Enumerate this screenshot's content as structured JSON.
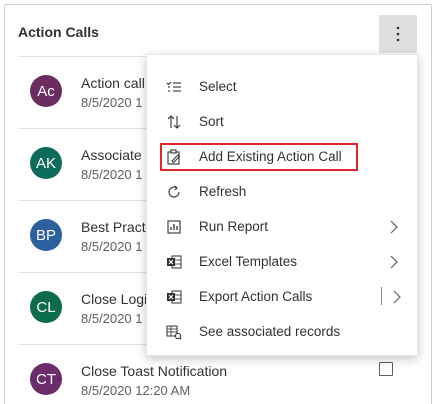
{
  "header": {
    "title": "Action Calls",
    "more_icon": "more-vertical-icon"
  },
  "rows": [
    {
      "initials": "Ac",
      "color": "#6b2c5f",
      "title": "Action call",
      "date": "8/5/2020 1"
    },
    {
      "initials": "AK",
      "color": "#0d6b5c",
      "title": "Associate K",
      "date": "8/5/2020 1"
    },
    {
      "initials": "BP",
      "color": "#2c5f9e",
      "title": "Best Practic",
      "date": "8/5/2020 1"
    },
    {
      "initials": "CL",
      "color": "#0d6b4e",
      "title": "Close Login",
      "date": "8/5/2020 1"
    },
    {
      "initials": "CT",
      "color": "#6b2c6b",
      "title": "Close Toast Notification",
      "date": "8/5/2020 12:20 AM"
    }
  ],
  "menu": {
    "items": [
      {
        "label": "Select",
        "icon": "select-list-icon",
        "has_chevron": false
      },
      {
        "label": "Sort",
        "icon": "sort-arrows-icon",
        "has_chevron": false
      },
      {
        "label": "Add Existing Action Call",
        "icon": "add-existing-icon",
        "has_chevron": false
      },
      {
        "label": "Refresh",
        "icon": "refresh-icon",
        "has_chevron": false
      },
      {
        "label": "Run Report",
        "icon": "report-icon",
        "has_chevron": true
      },
      {
        "label": "Excel Templates",
        "icon": "excel-icon",
        "has_chevron": true
      },
      {
        "label": "Export Action Calls",
        "icon": "excel-export-icon",
        "has_chevron": true,
        "split": true
      },
      {
        "label": "See associated records",
        "icon": "associated-records-icon",
        "has_chevron": false
      }
    ]
  },
  "accent": {
    "highlight": "#e0262b",
    "excel_green": "#217346"
  }
}
